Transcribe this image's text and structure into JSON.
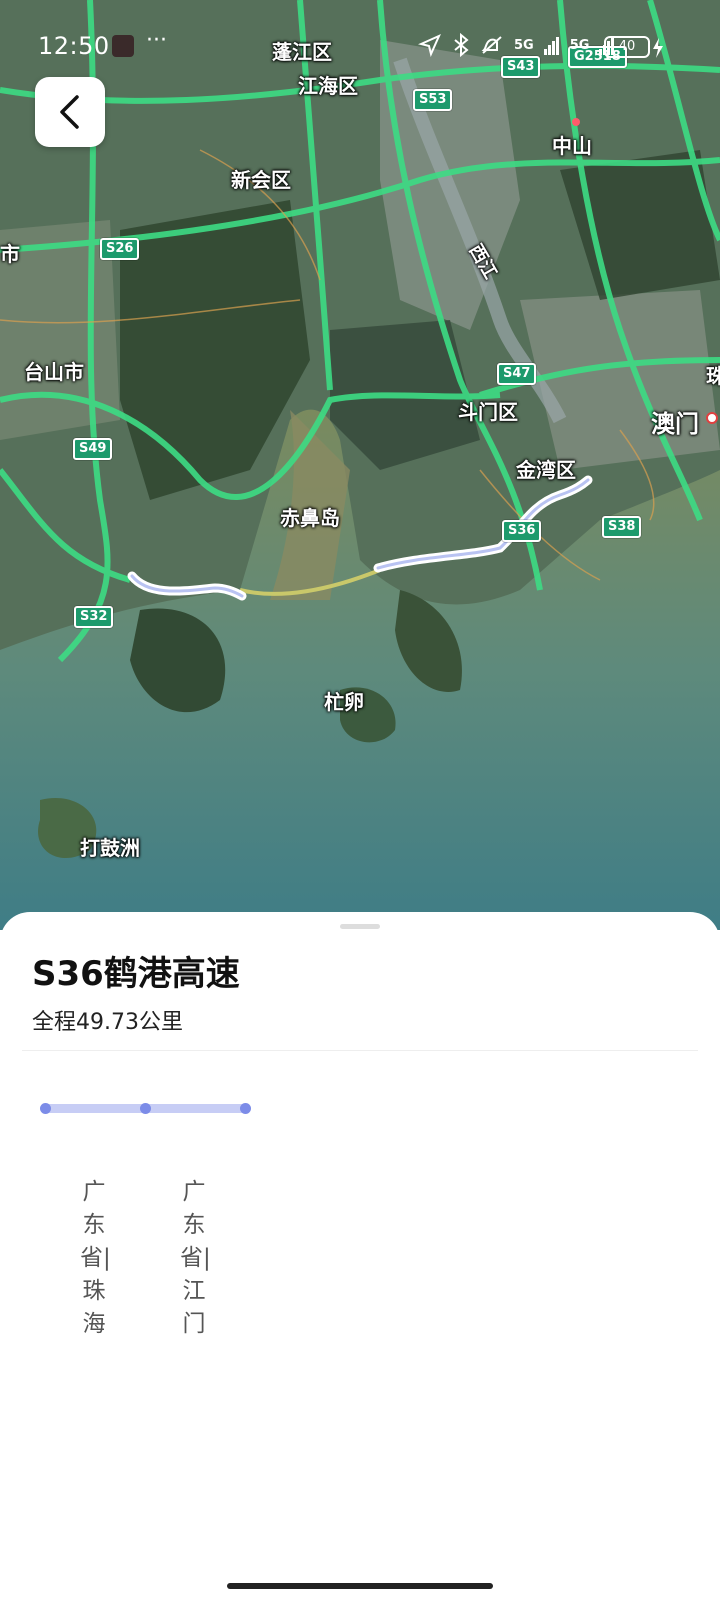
{
  "status": {
    "time": "12:50",
    "more": "···",
    "net1": "5G",
    "net2": "5G",
    "battery": "40"
  },
  "map": {
    "places": [
      {
        "id": "pengjiang",
        "label": "蓬江区",
        "big": false
      },
      {
        "id": "jianghai",
        "label": "江海区",
        "big": false
      },
      {
        "id": "zhongshan",
        "label": "中山",
        "big": false
      },
      {
        "id": "xinhui",
        "label": "新会区",
        "big": false
      },
      {
        "id": "shi",
        "label": "市",
        "big": false
      },
      {
        "id": "xijiang",
        "label": "西江",
        "big": false
      },
      {
        "id": "taishan",
        "label": "台山市",
        "big": false
      },
      {
        "id": "doumen",
        "label": "斗门区",
        "big": false
      },
      {
        "id": "aomen",
        "label": "澳门",
        "big": true
      },
      {
        "id": "jinwan",
        "label": "金湾区",
        "big": false
      },
      {
        "id": "chibidao",
        "label": "赤鼻岛",
        "big": false
      },
      {
        "id": "mangluan",
        "label": "杧卵",
        "big": false
      },
      {
        "id": "dagouzhou",
        "label": "打鼓洲",
        "big": false
      },
      {
        "id": "zhu",
        "label": "珠",
        "big": false
      }
    ],
    "shields": [
      "S43",
      "G2518",
      "S53",
      "S26",
      "S47",
      "S49",
      "S36",
      "S38",
      "S32"
    ]
  },
  "route": {
    "title": "S36鹤港高速",
    "length": "全程49.73公里",
    "stops": [
      {
        "label": "广东省|珠海"
      },
      {
        "label": "广东省|江门"
      }
    ]
  }
}
